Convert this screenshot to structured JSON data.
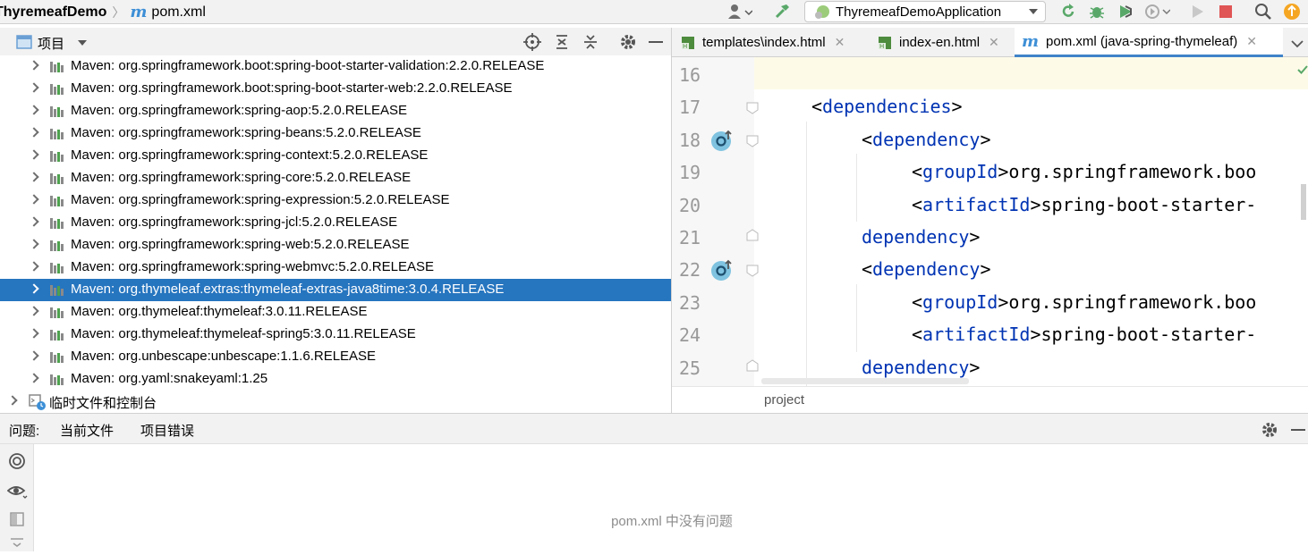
{
  "navbar": {
    "project_name": "ThyremeafDemo",
    "file_name": "pom.xml",
    "run_config": "ThyremeafDemoApplication",
    "icons": [
      "user-icon",
      "build-hammer-icon",
      "run-config-icon",
      "rerun-icon",
      "debug-icon",
      "coverage-icon",
      "profiler-icon",
      "run-icon",
      "stop-icon",
      "search-icon",
      "update-icon"
    ]
  },
  "project_panel": {
    "title": "项目",
    "icons": [
      "locate-icon",
      "expand-all-icon",
      "collapse-all-icon",
      "gear-icon",
      "hide-icon"
    ],
    "items": [
      {
        "label": "Maven: org.springframework.boot:spring-boot-starter-validation:2.2.0.RELEASE",
        "selected": false
      },
      {
        "label": "Maven: org.springframework.boot:spring-boot-starter-web:2.2.0.RELEASE",
        "selected": false
      },
      {
        "label": "Maven: org.springframework:spring-aop:5.2.0.RELEASE",
        "selected": false
      },
      {
        "label": "Maven: org.springframework:spring-beans:5.2.0.RELEASE",
        "selected": false
      },
      {
        "label": "Maven: org.springframework:spring-context:5.2.0.RELEASE",
        "selected": false
      },
      {
        "label": "Maven: org.springframework:spring-core:5.2.0.RELEASE",
        "selected": false
      },
      {
        "label": "Maven: org.springframework:spring-expression:5.2.0.RELEASE",
        "selected": false
      },
      {
        "label": "Maven: org.springframework:spring-jcl:5.2.0.RELEASE",
        "selected": false
      },
      {
        "label": "Maven: org.springframework:spring-web:5.2.0.RELEASE",
        "selected": false
      },
      {
        "label": "Maven: org.springframework:spring-webmvc:5.2.0.RELEASE",
        "selected": false
      },
      {
        "label": "Maven: org.thymeleaf.extras:thymeleaf-extras-java8time:3.0.4.RELEASE",
        "selected": true
      },
      {
        "label": "Maven: org.thymeleaf:thymeleaf:3.0.11.RELEASE",
        "selected": false
      },
      {
        "label": "Maven: org.thymeleaf:thymeleaf-spring5:3.0.11.RELEASE",
        "selected": false
      },
      {
        "label": "Maven: org.unbescape:unbescape:1.1.6.RELEASE",
        "selected": false
      },
      {
        "label": "Maven: org.yaml:snakeyaml:1.25",
        "selected": false
      }
    ],
    "scratch_label": "临时文件和控制台"
  },
  "editor_tabs": [
    {
      "label": "templates\\index.html",
      "active": false
    },
    {
      "label": "index-en.html",
      "active": false
    },
    {
      "label": "pom.xml (java-spring-thymeleaf)",
      "active": true
    }
  ],
  "editor": {
    "lines": [
      {
        "num": "16",
        "indent": "",
        "tag": "",
        "closing": false,
        "text": ""
      },
      {
        "num": "17",
        "indent": "    ",
        "tag": "dependencies",
        "closing": false,
        "text": ""
      },
      {
        "num": "18",
        "indent": "        ",
        "tag": "dependency",
        "closing": false,
        "text": ""
      },
      {
        "num": "19",
        "indent": "            ",
        "tag": "groupId",
        "closing": false,
        "text": "org.springframework.boo"
      },
      {
        "num": "20",
        "indent": "            ",
        "tag": "artifactId",
        "closing": false,
        "text": "spring-boot-starter-"
      },
      {
        "num": "21",
        "indent": "        ",
        "tag": "dependency",
        "closing": true,
        "text": ""
      },
      {
        "num": "22",
        "indent": "        ",
        "tag": "dependency",
        "closing": false,
        "text": ""
      },
      {
        "num": "23",
        "indent": "            ",
        "tag": "groupId",
        "closing": false,
        "text": "org.springframework.boo"
      },
      {
        "num": "24",
        "indent": "            ",
        "tag": "artifactId",
        "closing": false,
        "text": "spring-boot-starter-"
      },
      {
        "num": "25",
        "indent": "        ",
        "tag": "dependency",
        "closing": true,
        "text": ""
      }
    ],
    "breadcrumb": "project"
  },
  "problems": {
    "label": "问题:",
    "tabs": [
      {
        "label": "当前文件",
        "active": true
      },
      {
        "label": "项目错误",
        "active": false
      }
    ],
    "empty_message": "pom.xml 中没有问题"
  },
  "colors": {
    "selection": "#2675bf",
    "tag": "#0033b3",
    "accent": "#4083c9",
    "current_line": "#fdfbe8"
  }
}
